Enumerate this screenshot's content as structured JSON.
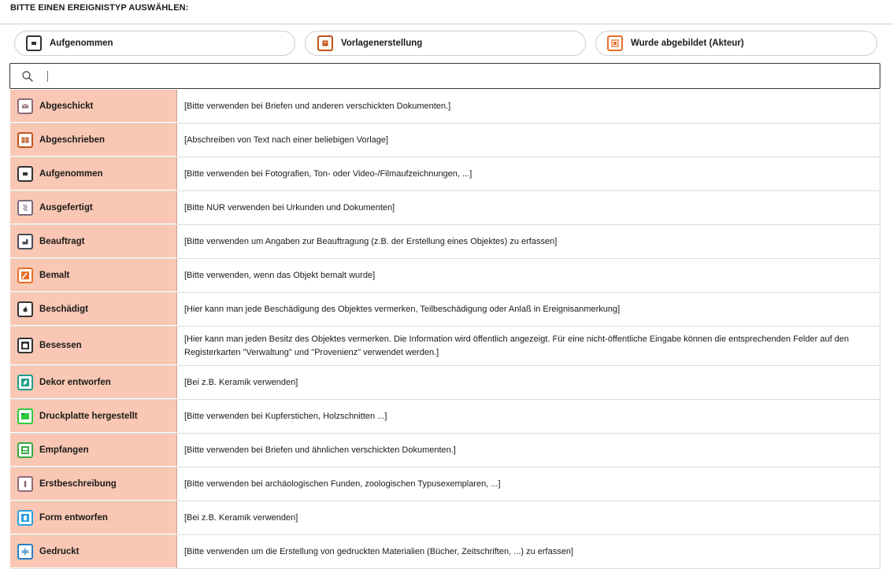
{
  "heading": "BITTE EINEN EREIGNISTYP AUSWÄHLEN:",
  "quick_picks": [
    {
      "label": "Aufgenommen",
      "icon": "camera-frame-icon",
      "color": "#333333"
    },
    {
      "label": "Vorlagenerstellung",
      "icon": "template-icon",
      "color": "#c0531b"
    },
    {
      "label": "Wurde abgebildet (Akteur)",
      "icon": "portrait-icon",
      "color": "#e8702a"
    }
  ],
  "search": {
    "value": "",
    "placeholder": ""
  },
  "rows": [
    {
      "label": "Abgeschickt",
      "icon": "envelope-icon",
      "color": "#8e6b7a",
      "desc": "[Bitte verwenden bei Briefen und anderen verschickten Dokumenten.]"
    },
    {
      "label": "Abgeschrieben",
      "icon": "book-copy-icon",
      "color": "#c0531b",
      "desc": "[Abschreiben von Text nach einer beliebigen Vorlage]"
    },
    {
      "label": "Aufgenommen",
      "icon": "camera-frame-icon",
      "color": "#333333",
      "desc": "[Bitte verwenden bei Fotografien, Ton- oder Video-/Filmaufzeichnungen, ...]"
    },
    {
      "label": "Ausgefertigt",
      "icon": "document-lines-icon",
      "color": "#7a6a7e",
      "desc": "[Bitte NUR verwenden bei Urkunden und Dokumenten]"
    },
    {
      "label": "Beauftragt",
      "icon": "commission-icon",
      "color": "#4a4a5a",
      "desc": "[Bitte verwenden um Angaben zur Beauftragung (z.B. der Erstellung eines Objektes) zu erfassen]"
    },
    {
      "label": "Bemalt",
      "icon": "paint-brush-icon",
      "color": "#e8702a",
      "desc": "[Bitte verwenden, wenn das Objekt bemalt wurde]"
    },
    {
      "label": "Beschädigt",
      "icon": "fire-icon",
      "color": "#333333",
      "desc": "[Hier kann man jede Beschädigung des Objektes vermerken, Teilbeschädigung oder Anlaß in Ereignisanmerkung]"
    },
    {
      "label": "Besessen",
      "icon": "possession-icon",
      "color": "#333333",
      "desc": "[Hier kann man jeden Besitz des Objektes vermerken. Die Information wird öffentlich angezeigt. Für eine nicht-öffentliche Eingabe können die entsprechenden Felder auf den Registerkarten \"Verwaltung\" und \"Provenienz\" verwendet werden.]"
    },
    {
      "label": "Dekor entworfen",
      "icon": "leaf-decor-icon",
      "color": "#1f9e8a",
      "desc": "[Bei z.B. Keramik verwenden]"
    },
    {
      "label": "Druckplatte hergestellt",
      "icon": "printing-plate-icon",
      "color": "#2ecc40",
      "desc": "[Bitte verwenden bei Kupferstichen, Holzschnitten ...]"
    },
    {
      "label": "Empfangen",
      "icon": "inbox-icon",
      "color": "#3aa845",
      "desc": "[Bitte verwenden bei Briefen und ähnlichen verschickten Dokumenten.]"
    },
    {
      "label": "Erstbeschreibung",
      "icon": "specimen-icon",
      "color": "#8e6b7a",
      "desc": "[Bitte verwenden bei archäologischen Funden, zoologischen Typusexemplaren, ...]"
    },
    {
      "label": "Form entworfen",
      "icon": "vase-form-icon",
      "color": "#2b9fe0",
      "desc": "[Bei z.B. Keramik verwenden]"
    },
    {
      "label": "Gedruckt",
      "icon": "print-icon",
      "color": "#2b7fc4",
      "desc": "[Bitte verwenden um die Erstellung von gedruckten Materialien (Bücher, Zeitschriften, ...) zu erfassen]"
    }
  ]
}
